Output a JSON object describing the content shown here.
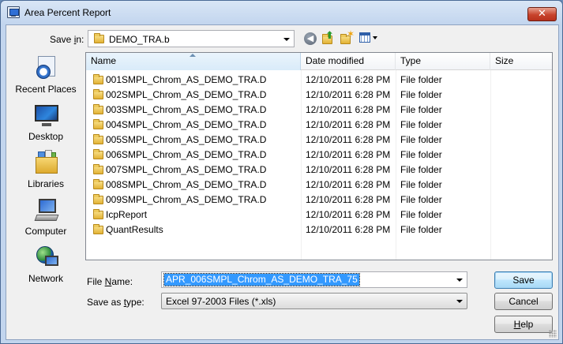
{
  "window": {
    "title": "Area Percent Report",
    "close_glyph": "✕"
  },
  "toolbar": {
    "save_in_label_pre": "Save ",
    "save_in_label_key": "i",
    "save_in_label_post": "n:",
    "current_folder": "DEMO_TRA.b",
    "icons": [
      "back-icon",
      "up-folder-icon",
      "new-folder-icon",
      "view-menu-icon"
    ]
  },
  "places": [
    {
      "label": "Recent Places",
      "icon": "recent-places-icon"
    },
    {
      "label": "Desktop",
      "icon": "desktop-icon"
    },
    {
      "label": "Libraries",
      "icon": "libraries-icon"
    },
    {
      "label": "Computer",
      "icon": "computer-icon"
    },
    {
      "label": "Network",
      "icon": "network-icon"
    }
  ],
  "columns": {
    "name": "Name",
    "date": "Date modified",
    "type": "Type",
    "size": "Size"
  },
  "files": [
    {
      "name": "001SMPL_Chrom_AS_DEMO_TRA.D",
      "date": "12/10/2011 6:28 PM",
      "type": "File folder"
    },
    {
      "name": "002SMPL_Chrom_AS_DEMO_TRA.D",
      "date": "12/10/2011 6:28 PM",
      "type": "File folder"
    },
    {
      "name": "003SMPL_Chrom_AS_DEMO_TRA.D",
      "date": "12/10/2011 6:28 PM",
      "type": "File folder"
    },
    {
      "name": "004SMPL_Chrom_AS_DEMO_TRA.D",
      "date": "12/10/2011 6:28 PM",
      "type": "File folder"
    },
    {
      "name": "005SMPL_Chrom_AS_DEMO_TRA.D",
      "date": "12/10/2011 6:28 PM",
      "type": "File folder"
    },
    {
      "name": "006SMPL_Chrom_AS_DEMO_TRA.D",
      "date": "12/10/2011 6:28 PM",
      "type": "File folder"
    },
    {
      "name": "007SMPL_Chrom_AS_DEMO_TRA.D",
      "date": "12/10/2011 6:28 PM",
      "type": "File folder"
    },
    {
      "name": "008SMPL_Chrom_AS_DEMO_TRA.D",
      "date": "12/10/2011 6:28 PM",
      "type": "File folder"
    },
    {
      "name": "009SMPL_Chrom_AS_DEMO_TRA.D",
      "date": "12/10/2011 6:28 PM",
      "type": "File folder"
    },
    {
      "name": "IcpReport",
      "date": "12/10/2011 6:28 PM",
      "type": "File folder"
    },
    {
      "name": "QuantResults",
      "date": "12/10/2011 6:28 PM",
      "type": "File folder"
    }
  ],
  "form": {
    "file_name_label_key": "N",
    "file_name_label_pre": "File ",
    "file_name_label_post": "ame:",
    "file_name_value": "APR_006SMPL_Chrom_AS_DEMO_TRA_75",
    "save_type_label_pre": "Save as ",
    "save_type_label_key": "t",
    "save_type_label_post": "ype:",
    "save_type_value": "Excel 97-2003 Files (*.xls)"
  },
  "buttons": {
    "save": "Save",
    "cancel": "Cancel",
    "help_key": "H",
    "help_rest": "elp"
  }
}
